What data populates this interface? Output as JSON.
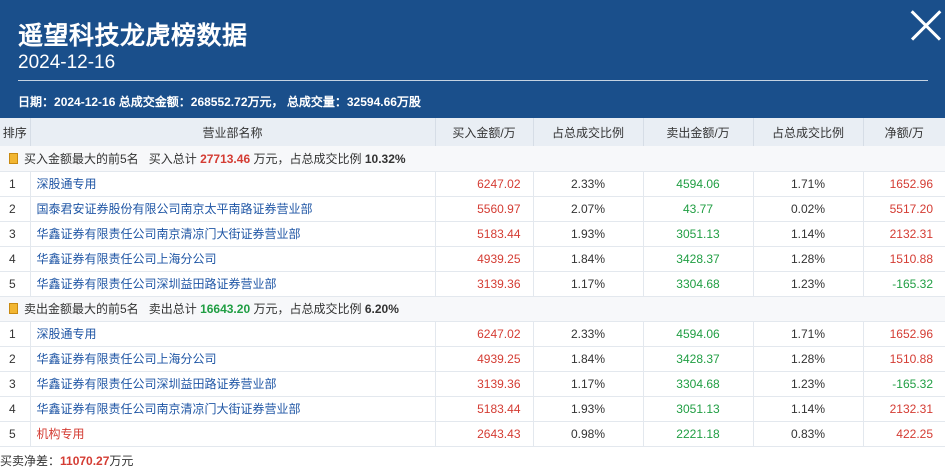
{
  "header": {
    "title": "遥望科技龙虎榜数据",
    "date": "2024-12-16",
    "summary_date_label": "日期：",
    "summary_date": "2024-12-16",
    "summary_amount_label": "总成交金额：",
    "summary_amount": "268552.72万元",
    "summary_volume_label": "总成交量：",
    "summary_volume": "32594.66万股"
  },
  "columns": [
    "排序",
    "营业部名称",
    "买入金额/万",
    "占总成交比例",
    "卖出金额/万",
    "占总成交比例",
    "净额/万"
  ],
  "buy_section": {
    "label": "买入金额最大的前5名",
    "total_label": "买入总计",
    "total": "27713.46",
    "unit": "万元，",
    "ratio_label": "占总成交比例",
    "ratio": "10.32%",
    "rows": [
      {
        "rank": "1",
        "name": "深股通专用",
        "buy": "6247.02",
        "buy_pct": "2.33%",
        "sell": "4594.06",
        "sell_pct": "1.71%",
        "net": "1652.96"
      },
      {
        "rank": "2",
        "name": "国泰君安证券股份有限公司南京太平南路证券营业部",
        "buy": "5560.97",
        "buy_pct": "2.07%",
        "sell": "43.77",
        "sell_pct": "0.02%",
        "net": "5517.20"
      },
      {
        "rank": "3",
        "name": "华鑫证券有限责任公司南京清凉门大街证券营业部",
        "buy": "5183.44",
        "buy_pct": "1.93%",
        "sell": "3051.13",
        "sell_pct": "1.14%",
        "net": "2132.31"
      },
      {
        "rank": "4",
        "name": "华鑫证券有限责任公司上海分公司",
        "buy": "4939.25",
        "buy_pct": "1.84%",
        "sell": "3428.37",
        "sell_pct": "1.28%",
        "net": "1510.88"
      },
      {
        "rank": "5",
        "name": "华鑫证券有限责任公司深圳益田路证券营业部",
        "buy": "3139.36",
        "buy_pct": "1.17%",
        "sell": "3304.68",
        "sell_pct": "1.23%",
        "net": "-165.32"
      }
    ]
  },
  "sell_section": {
    "label": "卖出金额最大的前5名",
    "total_label": "卖出总计",
    "total": "16643.20",
    "unit": "万元，",
    "ratio_label": "占总成交比例",
    "ratio": "6.20%",
    "rows": [
      {
        "rank": "1",
        "name": "深股通专用",
        "buy": "6247.02",
        "buy_pct": "2.33%",
        "sell": "4594.06",
        "sell_pct": "1.71%",
        "net": "1652.96"
      },
      {
        "rank": "2",
        "name": "华鑫证券有限责任公司上海分公司",
        "buy": "4939.25",
        "buy_pct": "1.84%",
        "sell": "3428.37",
        "sell_pct": "1.28%",
        "net": "1510.88"
      },
      {
        "rank": "3",
        "name": "华鑫证券有限责任公司深圳益田路证券营业部",
        "buy": "3139.36",
        "buy_pct": "1.17%",
        "sell": "3304.68",
        "sell_pct": "1.23%",
        "net": "-165.32"
      },
      {
        "rank": "4",
        "name": "华鑫证券有限责任公司南京清凉门大街证券营业部",
        "buy": "5183.44",
        "buy_pct": "1.93%",
        "sell": "3051.13",
        "sell_pct": "1.14%",
        "net": "2132.31"
      },
      {
        "rank": "5",
        "name": "机构专用",
        "buy": "2643.43",
        "buy_pct": "0.98%",
        "sell": "2221.18",
        "sell_pct": "0.83%",
        "net": "422.25"
      }
    ]
  },
  "footer": {
    "label": "买卖净差：",
    "value": "11070.27",
    "unit": "万元"
  },
  "colors": {
    "header_bg": "#1a4f8b",
    "red": "#d43c33",
    "green": "#209e43",
    "link_blue": "#1f56a5"
  }
}
